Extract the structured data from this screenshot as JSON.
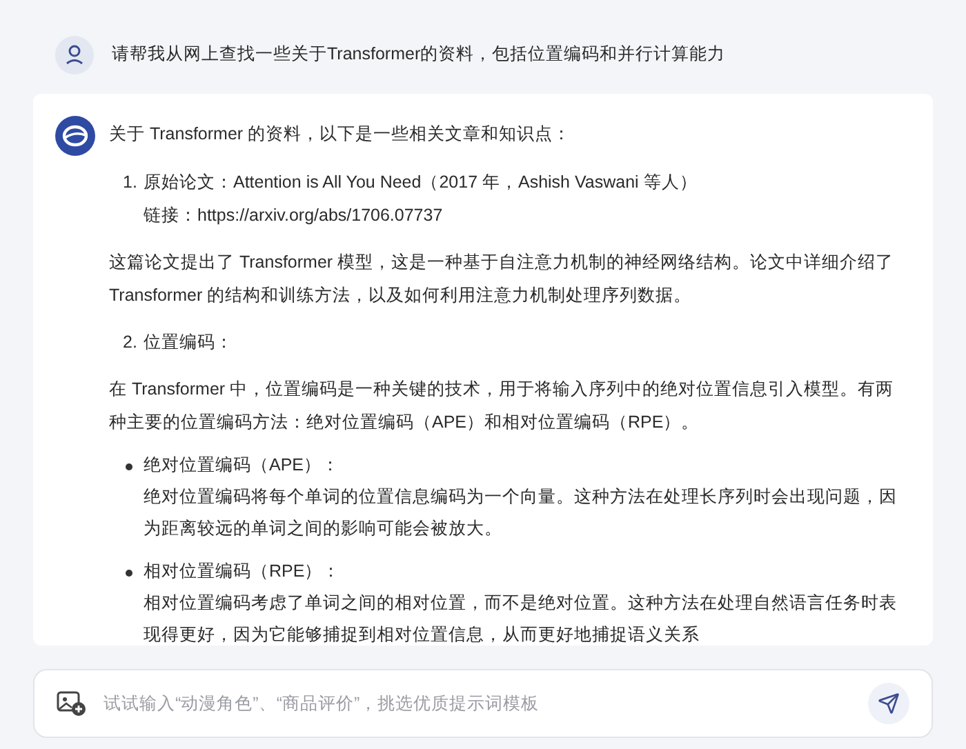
{
  "user_message": {
    "text": "请帮我从网上查找一些关于Transformer的资料，包括位置编码和并行计算能力"
  },
  "response": {
    "intro": "关于 Transformer 的资料，以下是一些相关文章和知识点：",
    "blocks": [
      {
        "kind": "numbered",
        "number": "1.",
        "title": "原始论文：Attention is All You Need（2017 年，Ashish Vaswani 等人）",
        "text": "链接：https://arxiv.org/abs/1706.07737"
      },
      {
        "kind": "paragraph",
        "text": "这篇论文提出了 Transformer 模型，这是一种基于自注意力机制的神经网络结构。论文中详细介绍了 Transformer 的结构和训练方法，以及如何利用注意力机制处理序列数据。"
      },
      {
        "kind": "numbered",
        "number": "2.",
        "title": "位置编码："
      },
      {
        "kind": "paragraph",
        "text": "在 Transformer 中，位置编码是一种关键的技术，用于将输入序列中的绝对位置信息引入模型。有两种主要的位置编码方法：绝对位置编码（APE）和相对位置编码（RPE）。"
      },
      {
        "kind": "bullet",
        "title": "绝对位置编码（APE）：",
        "text": "绝对位置编码将每个单词的位置信息编码为一个向量。这种方法在处理长序列时会出现问题，因为距离较远的单词之间的影响可能会被放大。"
      },
      {
        "kind": "bullet",
        "title": "相对位置编码（RPE）：",
        "text": "相对位置编码考虑了单词之间的相对位置，而不是绝对位置。这种方法在处理自然语言任务时表现得更好，因为它能够捕捉到相对位置信息，从而更好地捕捉语义关系"
      }
    ]
  },
  "composer": {
    "placeholder": "试试输入“动漫角色”、“商品评价”，挑选优质提示词模板"
  }
}
